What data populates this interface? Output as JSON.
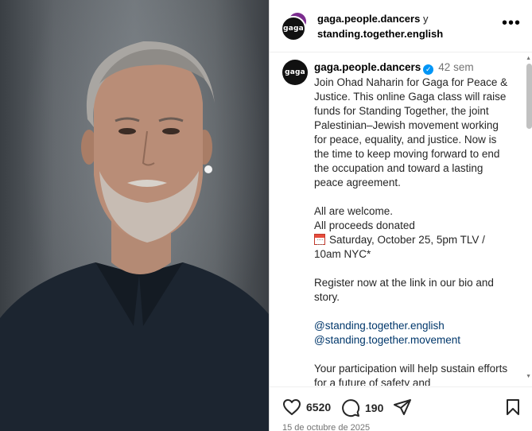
{
  "header": {
    "account_primary": "gaga.people.dancers",
    "conjunction": "y",
    "account_secondary": "standing.together.english",
    "avatar_text": "gaga",
    "more_label": "•••"
  },
  "caption": {
    "username": "gaga.people.dancers",
    "verified_mark": "✓",
    "time_ago": "42 sem",
    "paragraph1": "Join Ohad Naharin for Gaga for Peace & Justice. This online Gaga class will raise funds for Standing Together, the joint Palestinian–Jewish movement working for peace, equality, and justice. Now is the time to keep moving forward to end the occupation and toward a lasting peace agreement.",
    "welcome_line": "All are welcome.",
    "proceeds_line": "All proceeds donated",
    "date_line": "Saturday, October 25, 5pm TLV / 10am NYC*",
    "register_line": "Register now at the link in our bio and story.",
    "mention1": "@standing.together.english",
    "mention2": "@standing.together.movement",
    "participation_line": "Your participation will help sustain efforts for a future of safety and"
  },
  "actions": {
    "likes": "6520",
    "comments": "190"
  },
  "post_date": "15 de octubre de 2025"
}
